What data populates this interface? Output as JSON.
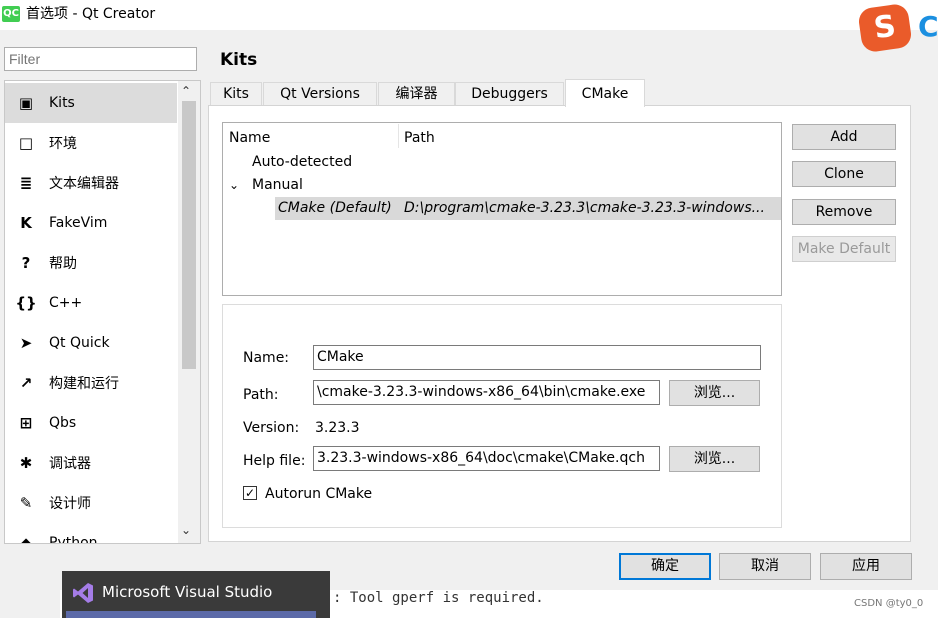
{
  "window": {
    "app_icon": "QC",
    "title": "首选项 - Qt Creator"
  },
  "sogou_ime": {
    "glyph": "S",
    "partial_letter": "C"
  },
  "filter": {
    "placeholder": "Filter"
  },
  "nav": {
    "items": [
      {
        "label": "Kits",
        "icon": "kits-icon",
        "glyph": "▣",
        "selected": true
      },
      {
        "label": "环境",
        "icon": "monitor-icon",
        "glyph": "□"
      },
      {
        "label": "文本编辑器",
        "icon": "text-editor-icon",
        "glyph": "≣"
      },
      {
        "label": "FakeVim",
        "icon": "fakevim-icon",
        "glyph": "K"
      },
      {
        "label": "帮助",
        "icon": "help-icon",
        "glyph": "?"
      },
      {
        "label": "C++",
        "icon": "cpp-icon",
        "glyph": "{}"
      },
      {
        "label": "Qt Quick",
        "icon": "qt-quick-icon",
        "glyph": "➤"
      },
      {
        "label": "构建和运行",
        "icon": "build-run-icon",
        "glyph": "↗"
      },
      {
        "label": "Qbs",
        "icon": "qbs-icon",
        "glyph": "⊞"
      },
      {
        "label": "调试器",
        "icon": "debugger-icon",
        "glyph": "✱"
      },
      {
        "label": "设计师",
        "icon": "designer-icon",
        "glyph": "✎"
      },
      {
        "label": "Python",
        "icon": "python-icon",
        "glyph": "◆"
      }
    ]
  },
  "page": {
    "title": "Kits"
  },
  "tabs": [
    {
      "label": "Kits",
      "active": false
    },
    {
      "label": "Qt Versions",
      "active": false
    },
    {
      "label": "编译器",
      "active": false
    },
    {
      "label": "Debuggers",
      "active": false
    },
    {
      "label": "CMake",
      "active": true
    }
  ],
  "tool_list": {
    "columns": [
      "Name",
      "Path"
    ],
    "groups": [
      {
        "label": "Auto-detected",
        "expanded": false
      },
      {
        "label": "Manual",
        "expanded": true
      }
    ],
    "rows": [
      {
        "name": "CMake (Default)",
        "path": "D:\\program\\cmake-3.23.3\\cmake-3.23.3-windows...",
        "selected": true
      }
    ]
  },
  "side_buttons": {
    "add": "Add",
    "clone": "Clone",
    "remove": "Remove",
    "make_default": "Make Default"
  },
  "details": {
    "name_label": "Name:",
    "name_value": "CMake",
    "path_label": "Path:",
    "path_value": "\\cmake-3.23.3-windows-x86_64\\bin\\cmake.exe",
    "version_label": "Version:",
    "version_value": "3.23.3",
    "help_label": "Help file:",
    "help_value": "3.23.3-windows-x86_64\\doc\\cmake\\CMake.qch",
    "browse_label": "浏览...",
    "autorun_label": "Autorun CMake",
    "autorun_checked": true
  },
  "dialog_buttons": {
    "ok": "确定",
    "cancel": "取消",
    "apply": "应用"
  },
  "taskbar_preview": {
    "title": "Microsoft Visual Studio"
  },
  "terminal": {
    "line": ": Tool gperf is required."
  },
  "watermark": "CSDN @ty0_0"
}
